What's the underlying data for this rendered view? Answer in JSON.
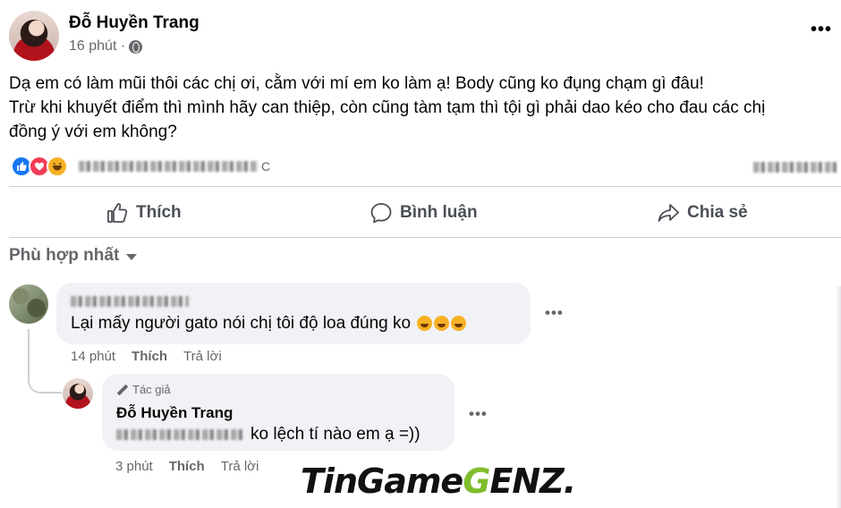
{
  "post": {
    "author": "Đỗ Huyền Trang",
    "time": "16 phút ·",
    "more": "•••",
    "lines": [
      "Dạ em có làm mũi thôi các chị ơi, cằm với mí em ko làm ạ! Body cũng ko đụng chạm gì đâu!",
      "Trừ khi khuyết điểm thì mình hãy can thiệp, còn cũng tàm tạm thì tội gì phải dao kéo cho đau các chị",
      "đồng ý với em không?"
    ],
    "reactions": {
      "icons": [
        "like-icon",
        "love-icon",
        "haha-icon"
      ],
      "names_suffix": "C"
    }
  },
  "actions": {
    "like": "Thích",
    "comment": "Bình luận",
    "share": "Chia sẻ"
  },
  "sort_label": "Phù hợp nhất",
  "comments": [
    {
      "text": "Lại mấy người gato nói chị tôi độ loa đúng ko",
      "emoji_count": 3,
      "time": "14 phút",
      "like": "Thích",
      "reply": "Trả lời",
      "more": "•••"
    }
  ],
  "reply": {
    "badge": "Tác giả",
    "author": "Đỗ Huyền Trang",
    "text": "ko lệch tí nào em ạ =))",
    "time": "3 phút",
    "like": "Thích",
    "reply": "Trả lời",
    "more": "•••"
  },
  "watermark": {
    "part1": "TinGame",
    "part2": "G",
    "part3": "ENZ."
  },
  "colors": {
    "accent": "#1877f2",
    "love": "#f33e58",
    "haha": "#f7b125",
    "watermark_green": "#7fbd2e"
  }
}
